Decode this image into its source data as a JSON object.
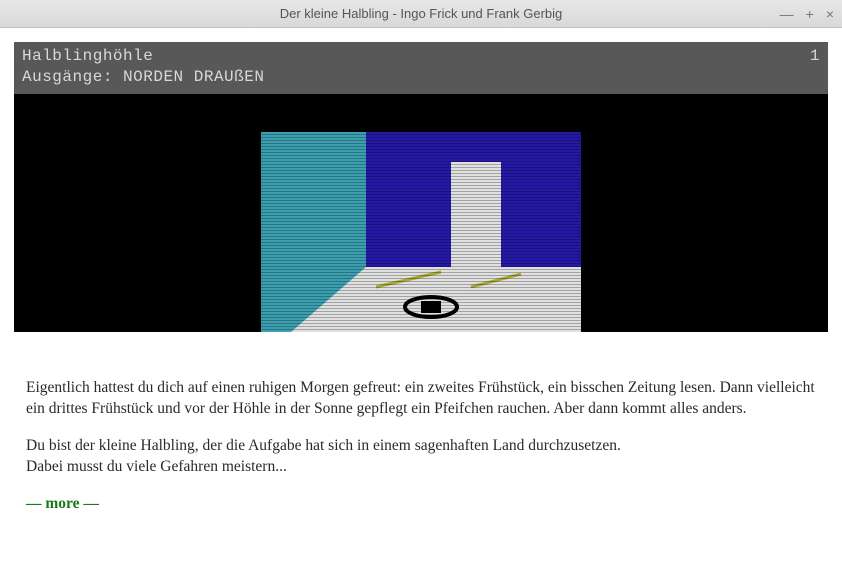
{
  "window": {
    "title": "Der kleine Halbling - Ingo Frick und Frank Gerbig"
  },
  "status": {
    "location": "Halblinghöhle",
    "counter": "1",
    "exits_label": "Ausgänge:",
    "exits_list": "NORDEN   DRAUßEN"
  },
  "story": {
    "p1": "Eigentlich hattest du dich auf einen ruhigen Morgen gefreut: ein zweites Frühstück, ein bisschen Zeitung lesen. Dann vielleicht ein drittes Frühstück und vor der Höhle in der Sonne gepflegt ein Pfeifchen rauchen. Aber dann kommt alles anders.",
    "p2": "Du bist der kleine Halbling, der die Aufgabe hat sich in einem sagenhaften Land durchzusetzen.",
    "p3": "Dabei musst du viele Gefahren meistern...",
    "more": "— more —"
  },
  "scene": {
    "colors": {
      "sky_left": "#3aa0b0",
      "sky_right": "#2418a8",
      "floor": "#e0e0e0",
      "door": "#e0e0e0",
      "floor_accent": "#a8a830"
    }
  }
}
